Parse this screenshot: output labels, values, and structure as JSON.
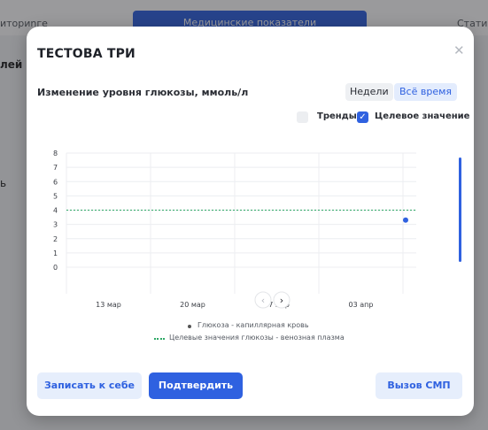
{
  "background": {
    "tab_left": "иториnге",
    "tab_active": "Медицинские показатели",
    "tab_right": "Стати",
    "side_text": "лей",
    "side_b": "ь"
  },
  "modal": {
    "title": "ТЕСТОВА ТРИ",
    "close_icon": "close-icon"
  },
  "controls": {
    "weeks_label": "Недели",
    "all_time_label": "Всё время",
    "trends_label": "Тренды",
    "trends_checked": false,
    "target_label": "Целевое значение",
    "target_checked": true
  },
  "chart_data": {
    "type": "scatter",
    "title": "Изменение уровня глюкозы, ммоль/л",
    "x_tick_labels": [
      "13 мар",
      "20 мар",
      "27 мар",
      "03 апр"
    ],
    "y_ticks": [
      0,
      1,
      2,
      3,
      4,
      5,
      6,
      7,
      8
    ],
    "ylim": [
      0,
      8
    ],
    "grid": true,
    "series": [
      {
        "name": "Глюкоза - капиллярная кровь",
        "color": "#2f61e0",
        "points": [
          {
            "x": "07 апр",
            "y": 3.3
          }
        ]
      },
      {
        "name": "Целевые значения глюкозы - венозная плазма",
        "color": "#2ea866",
        "style": "dotted",
        "value": 4
      }
    ],
    "pager_prev": "‹",
    "pager_next": "›"
  },
  "actions": {
    "save_label": "Записать к себе",
    "confirm_label": "Подтвердить",
    "emergency_label": "Вызов СМП"
  }
}
